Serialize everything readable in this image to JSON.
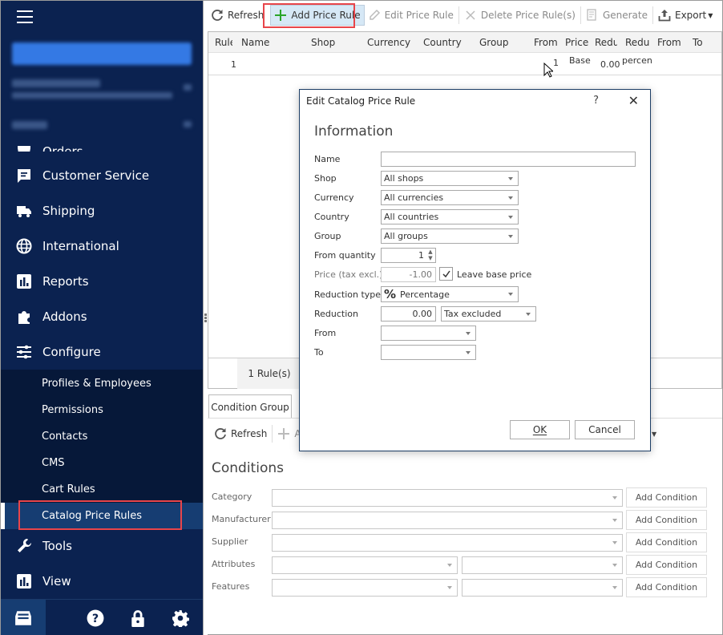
{
  "sidebar": {
    "nav": [
      {
        "label": "Orders",
        "icon": "orders-icon"
      },
      {
        "label": "Customer Service",
        "icon": "chat-icon"
      },
      {
        "label": "Shipping",
        "icon": "truck-icon"
      },
      {
        "label": "International",
        "icon": "globe-icon"
      },
      {
        "label": "Reports",
        "icon": "bar-chart-icon"
      },
      {
        "label": "Addons",
        "icon": "puzzle-icon"
      },
      {
        "label": "Configure",
        "icon": "sliders-icon"
      }
    ],
    "configure_submenu": [
      {
        "label": "Profiles & Employees"
      },
      {
        "label": "Permissions"
      },
      {
        "label": "Contacts"
      },
      {
        "label": "CMS"
      },
      {
        "label": "Cart Rules"
      },
      {
        "label": "Catalog Price Rules",
        "active": true
      }
    ],
    "nav_after": [
      {
        "label": "Tools",
        "icon": "wrench-icon"
      },
      {
        "label": "View",
        "icon": "bar-chart-icon"
      }
    ],
    "bottom_icons": [
      "inbox-icon",
      "help-icon",
      "lock-icon",
      "gear-icon"
    ]
  },
  "toolbar": {
    "refresh": "Refresh",
    "add": "Add Price Rule",
    "edit": "Edit Price Rule",
    "delete": "Delete Price Rule(s)",
    "generate": "Generate",
    "export": "Export"
  },
  "grid": {
    "columns": [
      "Rule",
      "Name",
      "Shop",
      "Currency",
      "Country",
      "Group",
      "From",
      "Price",
      "Redu",
      "Redu",
      "From",
      "To"
    ],
    "rows": [
      {
        "rule": "1",
        "name": "",
        "shop": "",
        "currency": "",
        "country": "",
        "group": "",
        "from_qty": "1",
        "price": "Base",
        "reduction": "0.00",
        "reduction_type": "percen",
        "from": "",
        "to": ""
      }
    ],
    "footer_count": "1 Rule(s)"
  },
  "conditions": {
    "tab": "Condition Group",
    "refresh": "Refresh",
    "add_partial": "Ad",
    "title": "Conditions",
    "rows": [
      {
        "label": "Category",
        "combos": 1
      },
      {
        "label": "Manufacturer",
        "combos": 1
      },
      {
        "label": "Supplier",
        "combos": 1
      },
      {
        "label": "Attributes",
        "combos": 2
      },
      {
        "label": "Features",
        "combos": 2
      }
    ],
    "add_condition": "Add Condition"
  },
  "dialog": {
    "title": "Edit Catalog Price Rule",
    "help": "?",
    "section": "Information",
    "fields": {
      "name": {
        "label": "Name",
        "value": ""
      },
      "shop": {
        "label": "Shop",
        "value": "All shops"
      },
      "currency": {
        "label": "Currency",
        "value": "All currencies"
      },
      "country": {
        "label": "Country",
        "value": "All countries"
      },
      "group": {
        "label": "Group",
        "value": "All groups"
      },
      "from_quantity": {
        "label": "From quantity",
        "value": "1"
      },
      "price": {
        "label": "Price (tax excl.)",
        "value": "-1.00"
      },
      "leave_base_price": {
        "label": "Leave base price",
        "checked": true
      },
      "reduction_type": {
        "label": "Reduction type",
        "value": "Percentage"
      },
      "reduction": {
        "label": "Reduction",
        "value": "0.00",
        "tax": "Tax excluded"
      },
      "from": {
        "label": "From",
        "value": ""
      },
      "to": {
        "label": "To",
        "value": ""
      }
    },
    "ok": "OK",
    "cancel": "Cancel"
  },
  "colors": {
    "sidebar_bg": "#0b2250",
    "submenu_bg": "#061839",
    "active_bg": "#163d72",
    "highlight": "#e8454a",
    "add_green": "#2aa52a"
  }
}
